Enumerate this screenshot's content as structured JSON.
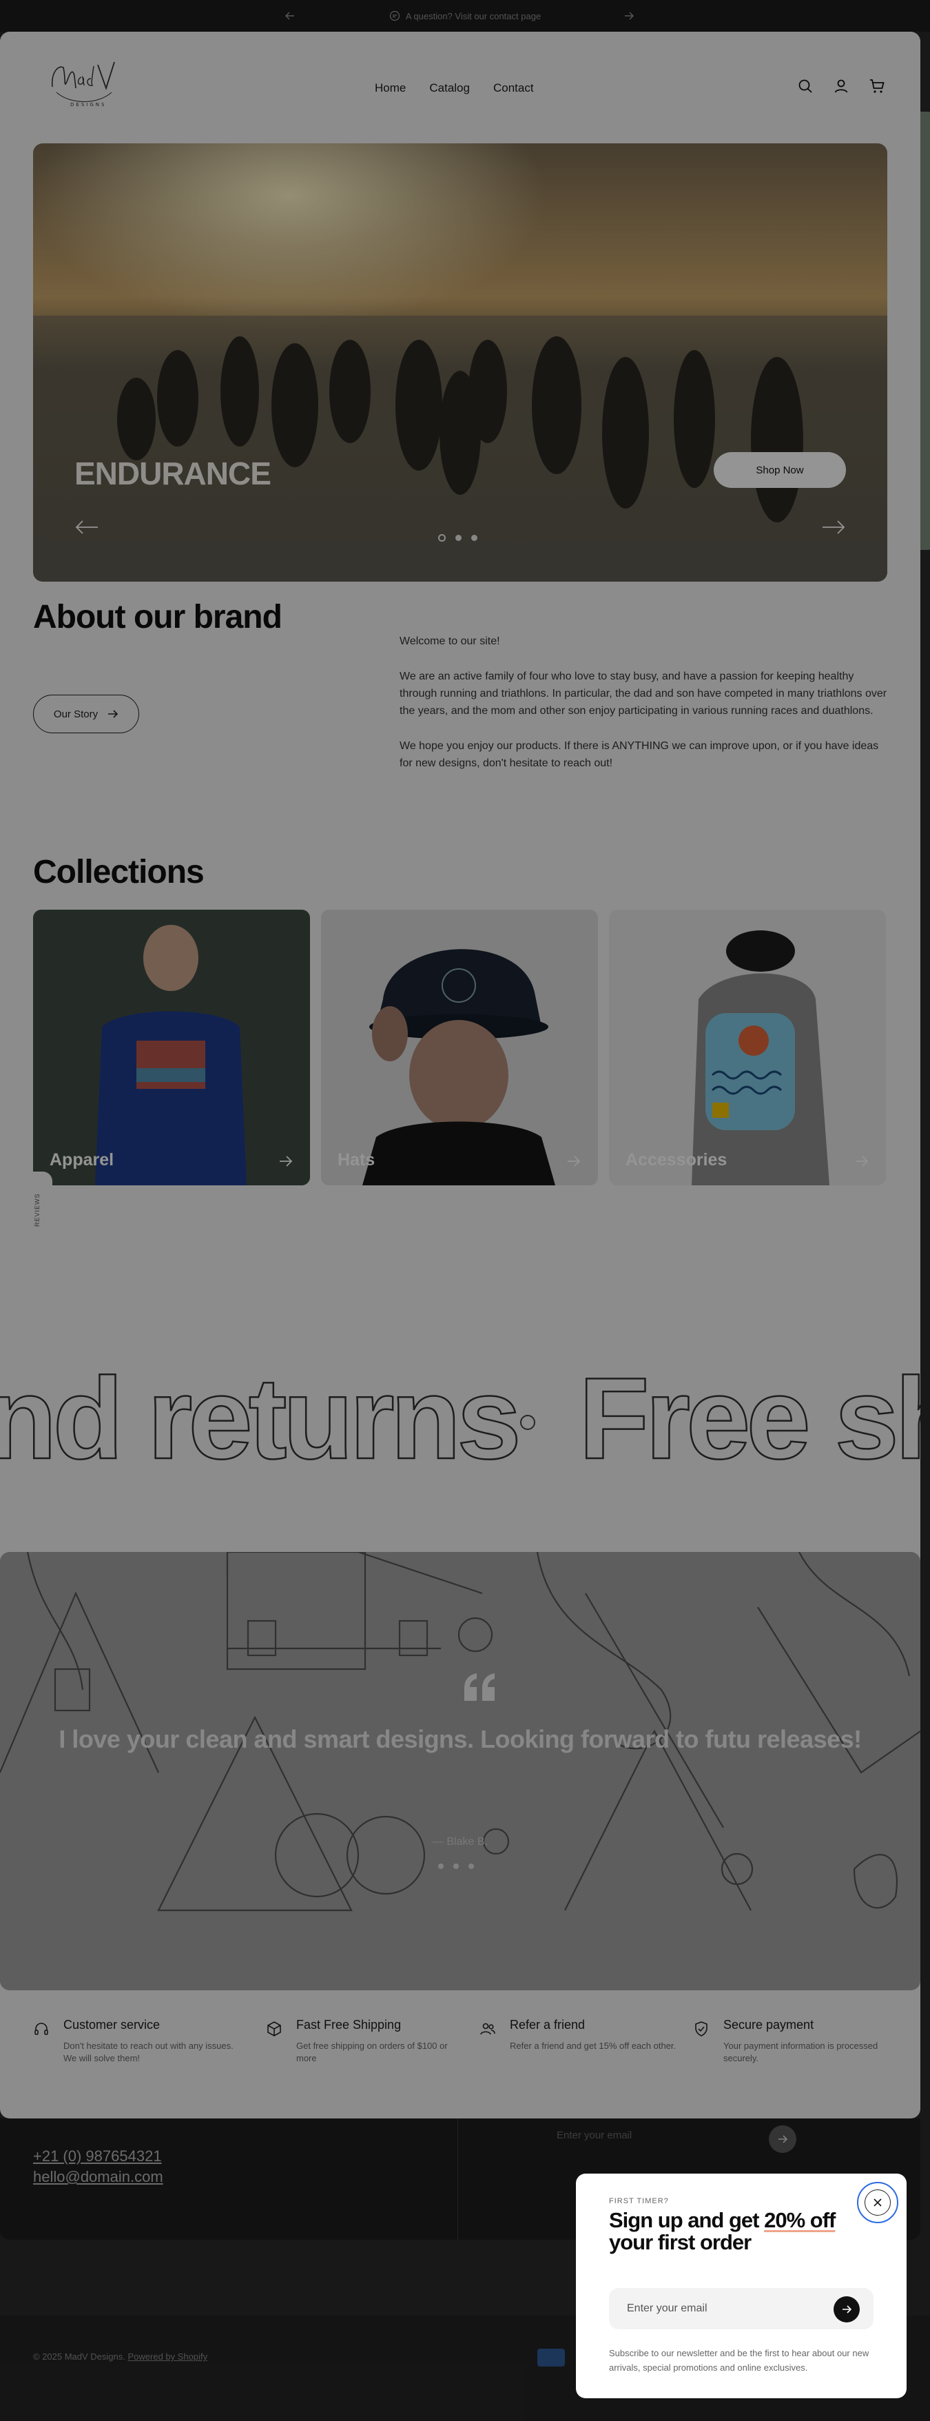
{
  "announcement": {
    "text": "A question? Visit our contact page"
  },
  "header": {
    "logo_text": "MadV Designs",
    "nav": [
      {
        "label": "Home"
      },
      {
        "label": "Catalog"
      },
      {
        "label": "Contact"
      }
    ]
  },
  "hero": {
    "title": "ENDURANCE",
    "cta": "Shop Now",
    "slide_count": 3,
    "active_slide": 1
  },
  "about": {
    "title": "About our brand",
    "button": "Our Story",
    "paragraphs": [
      "Welcome to our site!",
      "We are an active family of four who love to stay busy, and have a passion for keeping healthy through running and triathlons. In particular, the dad and son have competed in many triathlons over the years, and the mom and other son enjoy participating in various running races and duathlons.",
      "We hope you enjoy our products. If there is ANYTHING we can improve upon, or if you have ideas for new designs, don't hesitate to reach out!"
    ]
  },
  "collections": {
    "title": "Collections",
    "items": [
      {
        "label": "Apparel"
      },
      {
        "label": "Hats"
      },
      {
        "label": "Accessories"
      }
    ]
  },
  "side_tab": {
    "label": "REVIEWS"
  },
  "marquee": {
    "text_left": "nd returns",
    "text_right": "Free sh"
  },
  "testimonial": {
    "quote": "I love your clean and smart designs. Looking forward to futu releases!",
    "author": "— Blake B."
  },
  "features": [
    {
      "icon": "headset-icon",
      "title": "Customer service",
      "text": "Don't hesitate to reach out with any issues. We will solve them!"
    },
    {
      "icon": "box-icon",
      "title": "Fast Free Shipping",
      "text": "Get free shipping on orders of $100 or more"
    },
    {
      "icon": "users-icon",
      "title": "Refer a friend",
      "text": "Refer a friend and get 15% off each other."
    },
    {
      "icon": "shield-check-icon",
      "title": "Secure payment",
      "text": "Your payment information is processed securely."
    }
  ],
  "footer": {
    "phone": "+21 (0) 987654321",
    "email": "hello@domain.com",
    "newsletter_placeholder": "Enter your email",
    "copyright": "© 2025 MadV Designs.",
    "powered": "Powered by Shopify"
  },
  "popup": {
    "eyebrow": "FIRST TIMER?",
    "title_start": "Sign up and get ",
    "title_highlight": "20% off",
    "title_end": " your first order",
    "input_placeholder": "Enter your email",
    "note": "Subscribe to our newsletter and be the first to hear about our new arrivals, special promotions and online exclusives."
  },
  "colors": {
    "page_bg": "#f2f2f2",
    "dark": "#1e1e1e",
    "focus_ring": "#2d6cdf",
    "highlight": "#f0a58a"
  }
}
